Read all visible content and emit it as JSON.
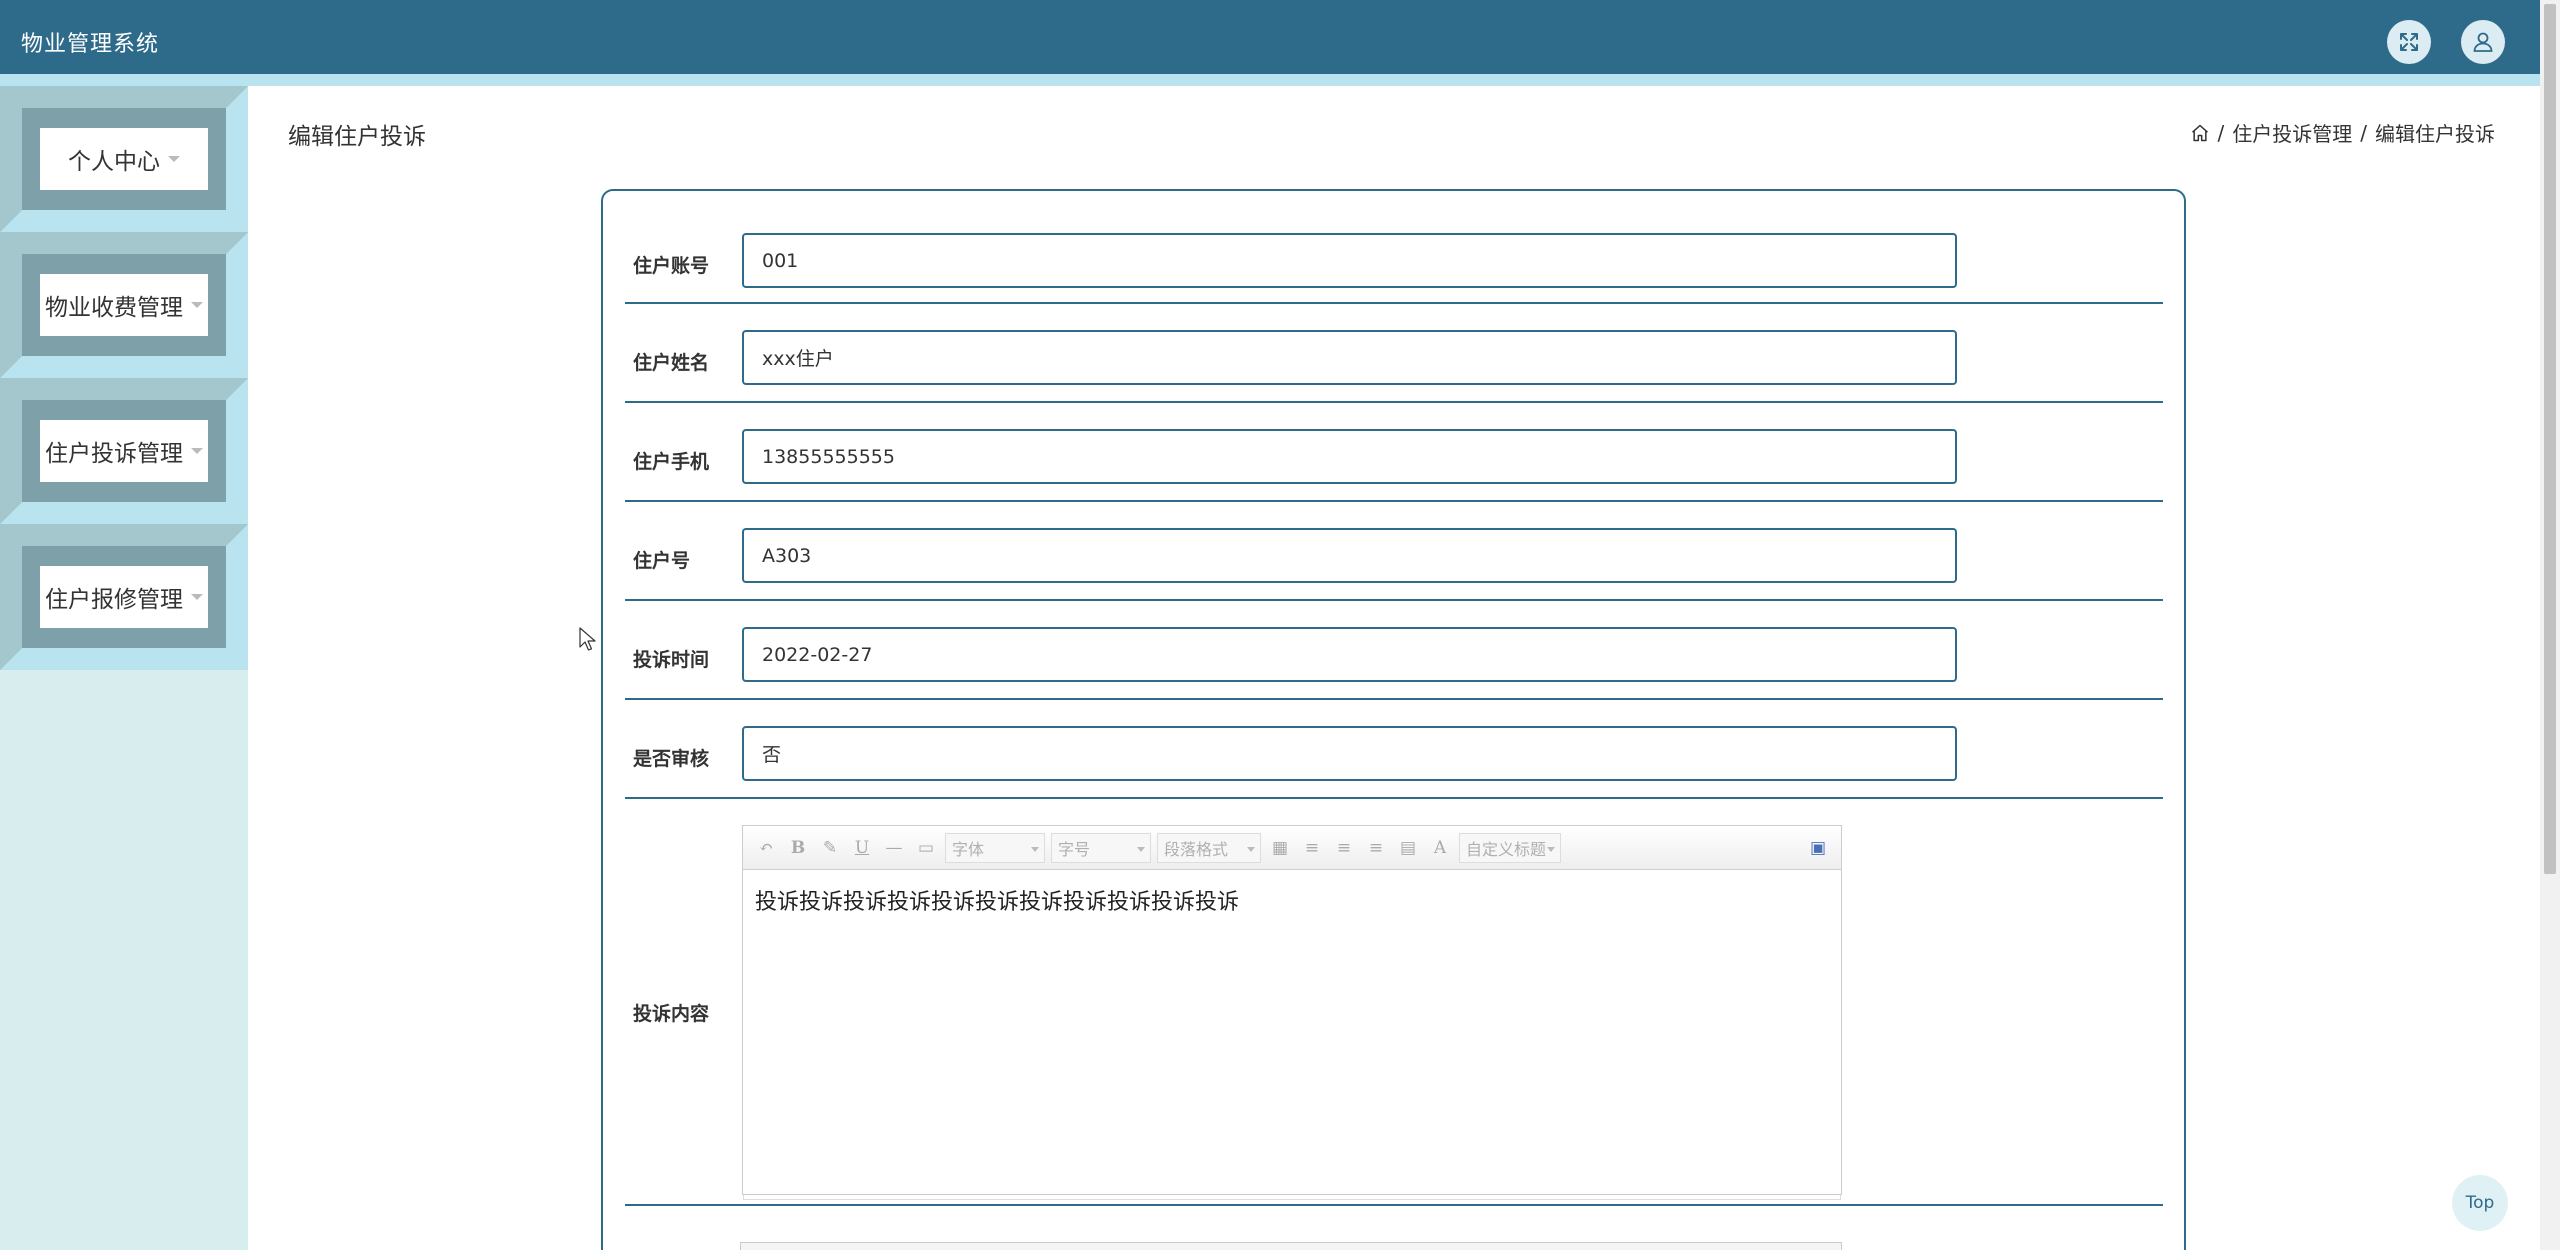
{
  "header": {
    "app_title": "物业管理系统",
    "fullscreen_icon": "fullscreen-expand-icon",
    "user_icon": "user-icon"
  },
  "sidebar": {
    "items": [
      {
        "label": "个人中心"
      },
      {
        "label": "物业收费管理"
      },
      {
        "label": "住户投诉管理"
      },
      {
        "label": "住户报修管理"
      }
    ]
  },
  "page": {
    "title": "编辑住户投诉",
    "breadcrumb": {
      "home_icon": "home-icon",
      "separator": "/",
      "level1": "住户投诉管理",
      "level2": "编辑住户投诉"
    }
  },
  "form": {
    "fields": [
      {
        "label": "住户账号",
        "value": "001"
      },
      {
        "label": "住户姓名",
        "value": "xxx住户"
      },
      {
        "label": "住户手机",
        "value": "13855555555"
      },
      {
        "label": "住户号",
        "value": "A303"
      },
      {
        "label": "投诉时间",
        "value": "2022-02-27"
      },
      {
        "label": "是否审核",
        "value": "否"
      }
    ],
    "content": {
      "label": "投诉内容",
      "text": "投诉投诉投诉投诉投诉投诉投诉投诉投诉投诉投诉",
      "toolbar": {
        "font_family": "字体",
        "font_size": "字号",
        "paragraph": "段落格式",
        "custom_title": "自定义标题"
      }
    }
  },
  "back_to_top": "Top"
}
